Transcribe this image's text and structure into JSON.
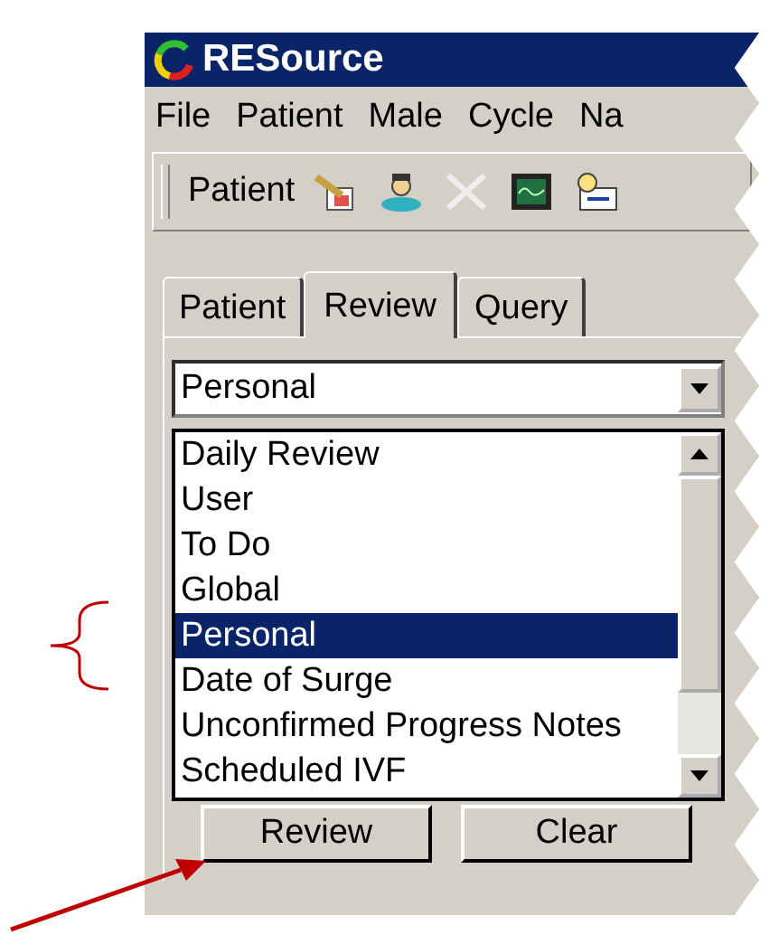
{
  "window": {
    "title": "RESource"
  },
  "menu": [
    {
      "label": "File"
    },
    {
      "label": "Patient"
    },
    {
      "label": "Male"
    },
    {
      "label": "Cycle"
    },
    {
      "label": "Na"
    }
  ],
  "toolbar": {
    "label": "Patient"
  },
  "tabs": [
    {
      "label": "Patient",
      "selected": false
    },
    {
      "label": "Review",
      "selected": true
    },
    {
      "label": "Query",
      "selected": false
    }
  ],
  "combo": {
    "value": "Personal"
  },
  "dropdown": {
    "items": [
      {
        "label": "Daily Review",
        "selected": false
      },
      {
        "label": "User",
        "selected": false
      },
      {
        "label": "To Do",
        "selected": false
      },
      {
        "label": "Global",
        "selected": false
      },
      {
        "label": "Personal",
        "selected": true
      },
      {
        "label": "Date of Surge",
        "selected": false
      },
      {
        "label": "Unconfirmed Progress Notes",
        "selected": false
      },
      {
        "label": "Scheduled IVF",
        "selected": false
      }
    ]
  },
  "buttons": [
    {
      "label": "Review"
    },
    {
      "label": "Clear"
    }
  ]
}
